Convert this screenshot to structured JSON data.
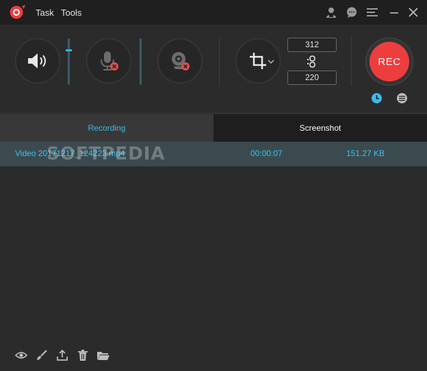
{
  "menu": {
    "task": "Task",
    "tools": "Tools"
  },
  "controls": {
    "width": "312",
    "height": "220",
    "rec_label": "REC"
  },
  "tabs": {
    "recording": "Recording",
    "screenshot": "Screenshot"
  },
  "rows": [
    {
      "name": "Video 20171217_124223.mp4",
      "duration": "00:00:07",
      "size": "151.27 KB"
    }
  ],
  "watermark": "SOFTPEDIA",
  "colors": {
    "accent": "#3cb9ea",
    "rec": "#ee3d3e",
    "badge": "#d9534f"
  }
}
